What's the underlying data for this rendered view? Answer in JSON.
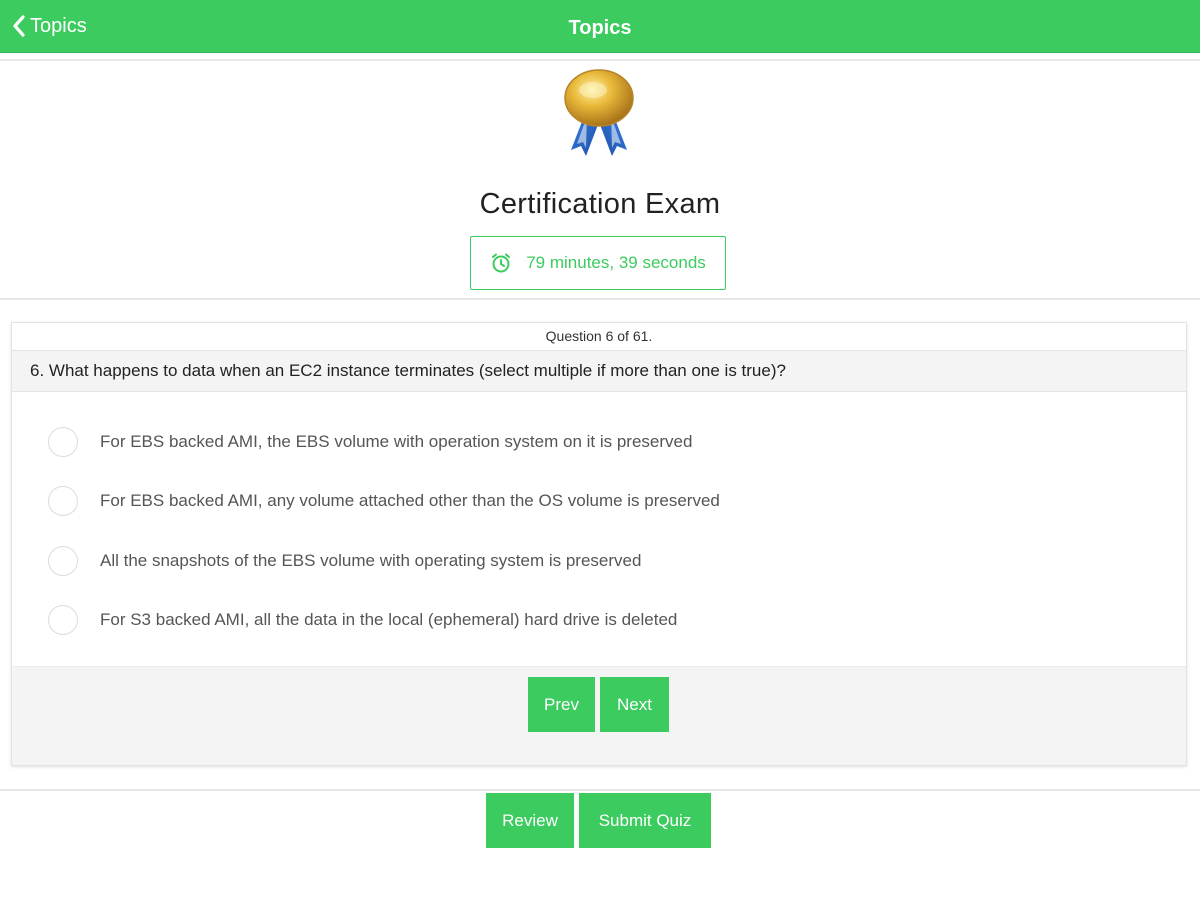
{
  "navbar": {
    "back_label": "Topics",
    "title": "Topics",
    "accent_color": "#3ccb5f"
  },
  "header": {
    "medal_icon": "award-medal-icon",
    "exam_title": "Certification Exam",
    "timer_icon": "alarm-clock-icon",
    "timer_text": "79 minutes, 39 seconds"
  },
  "question": {
    "counter": "Question 6 of 61.",
    "text": "6. What happens to data when an EC2 instance terminates (select multiple if more than one is true)?",
    "options": [
      {
        "label": "For EBS backed AMI, the EBS volume with operation system on it is preserved",
        "selected": false
      },
      {
        "label": "For EBS backed AMI, any volume attached other than the OS volume is preserved",
        "selected": false
      },
      {
        "label": "All the snapshots of the EBS volume with operating system is preserved",
        "selected": false
      },
      {
        "label": "For S3 backed AMI, all the data in the local (ephemeral) hard drive is deleted",
        "selected": false
      }
    ]
  },
  "navigation": {
    "prev_label": "Prev",
    "next_label": "Next"
  },
  "actions": {
    "review_label": "Review",
    "submit_label": "Submit Quiz"
  }
}
